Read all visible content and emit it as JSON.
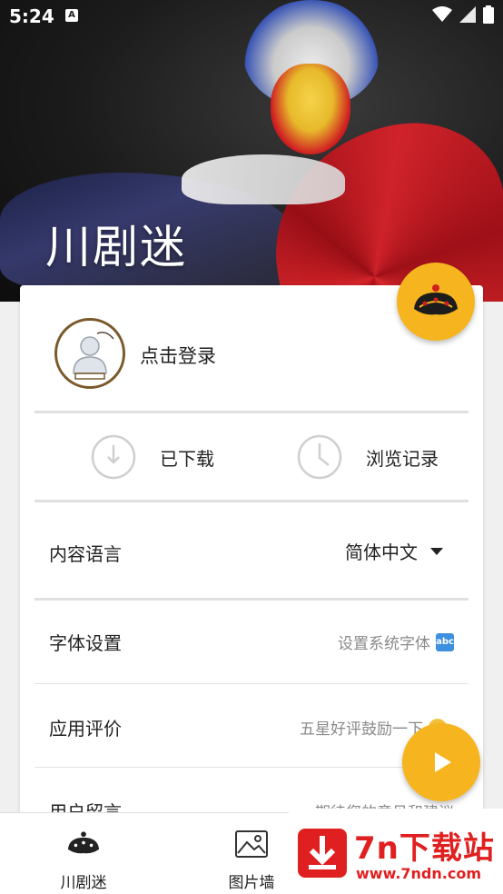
{
  "status_bar": {
    "time": "5:24",
    "notification_glyph": "A"
  },
  "header": {
    "app_title": "川剧迷"
  },
  "account": {
    "login_prompt": "点击登录"
  },
  "quick_actions": [
    {
      "label": "已下载",
      "icon": "download-clock-icon"
    },
    {
      "label": "浏览记录",
      "icon": "history-clock-icon"
    }
  ],
  "settings": [
    {
      "name": "内容语言",
      "value": "简体中文"
    },
    {
      "name": "字体设置",
      "value": "设置系统字体"
    },
    {
      "name": "应用评价",
      "value": "五星好评鼓励一下"
    },
    {
      "name": "用户留言",
      "value": "期待您的意见和建议"
    }
  ],
  "bottom_nav": [
    {
      "label": "川剧迷"
    },
    {
      "label": "图片墙"
    }
  ],
  "watermark": {
    "title": "7n下载站",
    "url": "www.7ndn.com"
  },
  "colors": {
    "accent": "#f6b51f",
    "watermark_red": "#e02020"
  }
}
